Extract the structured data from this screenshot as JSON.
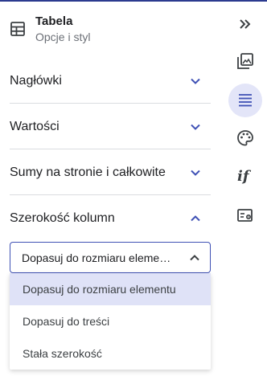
{
  "header": {
    "icon": "table-icon",
    "title": "Tabela",
    "subtitle": "Opcje i styl"
  },
  "sections": [
    {
      "label": "Nagłówki",
      "expanded": false
    },
    {
      "label": "Wartości",
      "expanded": false
    },
    {
      "label": "Sumy na stronie i całkowite",
      "expanded": false
    },
    {
      "label": "Szerokość kolumn",
      "expanded": true
    }
  ],
  "column_width": {
    "selected_value": "Dopasuj do rozmiaru elementu",
    "options": [
      {
        "label": "Dopasuj do rozmiaru elementu",
        "selected": true
      },
      {
        "label": "Dopasuj do treści",
        "selected": false
      },
      {
        "label": "Stała szerokość",
        "selected": false
      }
    ]
  },
  "rail": {
    "items": [
      {
        "icon": "collapse-panel-icon"
      },
      {
        "icon": "image-gallery-icon"
      },
      {
        "icon": "text-lines-icon",
        "active": true
      },
      {
        "icon": "palette-icon"
      },
      {
        "icon": "conditional-if-icon",
        "text": "if"
      },
      {
        "icon": "table-settings-icon"
      }
    ]
  },
  "colors": {
    "accent": "#3f51b5",
    "selected_bg": "#dfe2f7",
    "rail_active_bg": "#e3e5f8",
    "text": "#202124",
    "muted": "#6b6f76"
  }
}
